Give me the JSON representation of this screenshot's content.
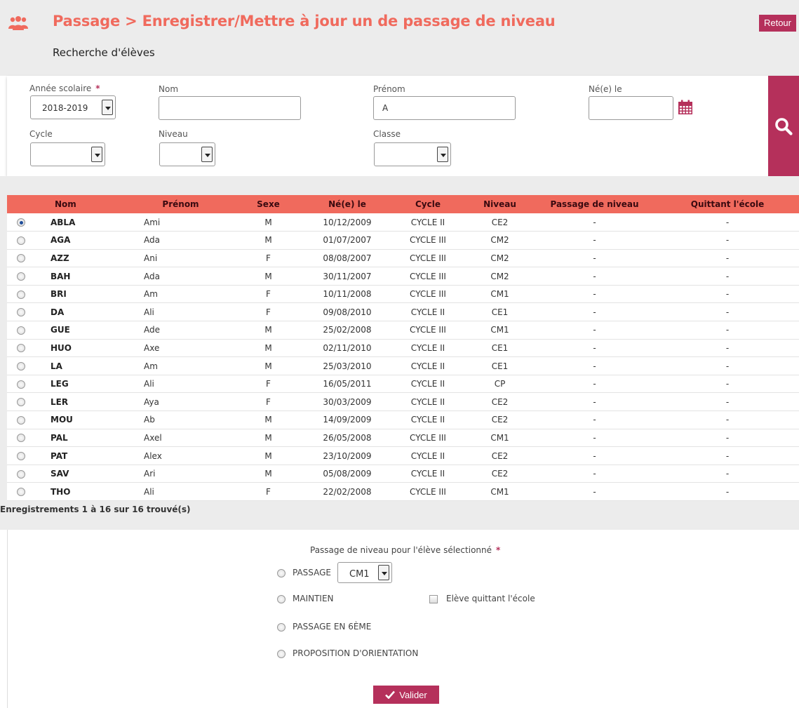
{
  "header": {
    "title": "Passage > Enregistrer/Mettre à jour un de passage de niveau",
    "back_label": "Retour",
    "subtitle": "Recherche d'élèves"
  },
  "search": {
    "annee": {
      "label": "Année scolaire",
      "required_mark": "*",
      "value": "2018-2019"
    },
    "nom": {
      "label": "Nom",
      "value": ""
    },
    "prenom": {
      "label": "Prénom",
      "value": "A"
    },
    "ne_le": {
      "label": "Né(e) le",
      "value": ""
    },
    "cycle": {
      "label": "Cycle",
      "value": ""
    },
    "niveau": {
      "label": "Niveau",
      "value": ""
    },
    "classe": {
      "label": "Classe",
      "value": ""
    },
    "search_icon": "search-icon",
    "calendar_icon": "calendar-icon"
  },
  "table": {
    "columns": [
      "Nom",
      "Prénom",
      "Sexe",
      "Né(e) le",
      "Cycle",
      "Niveau",
      "Passage de niveau",
      "Quittant l'école"
    ],
    "rows": [
      {
        "selected": true,
        "nom": "ABLA",
        "prenom": "Ami",
        "sexe": "M",
        "ne": "10/12/2009",
        "cycle": "CYCLE II",
        "niveau": "CE2",
        "passage": "-",
        "quittant": "-"
      },
      {
        "selected": false,
        "nom": "AGA",
        "prenom": "Ada",
        "sexe": "M",
        "ne": "01/07/2007",
        "cycle": "CYCLE III",
        "niveau": "CM2",
        "passage": "-",
        "quittant": "-"
      },
      {
        "selected": false,
        "nom": "AZZ",
        "prenom": "Ani",
        "sexe": "F",
        "ne": "08/08/2007",
        "cycle": "CYCLE III",
        "niveau": "CM2",
        "passage": "-",
        "quittant": "-"
      },
      {
        "selected": false,
        "nom": "BAH",
        "prenom": "Ada",
        "sexe": "M",
        "ne": "30/11/2007",
        "cycle": "CYCLE III",
        "niveau": "CM2",
        "passage": "-",
        "quittant": "-"
      },
      {
        "selected": false,
        "nom": "BRI",
        "prenom": "Am",
        "sexe": "F",
        "ne": "10/11/2008",
        "cycle": "CYCLE III",
        "niveau": "CM1",
        "passage": "-",
        "quittant": "-"
      },
      {
        "selected": false,
        "nom": "DA",
        "prenom": "Ali",
        "sexe": "F",
        "ne": "09/08/2010",
        "cycle": "CYCLE II",
        "niveau": "CE1",
        "passage": "-",
        "quittant": "-"
      },
      {
        "selected": false,
        "nom": "GUE",
        "prenom": "Ade",
        "sexe": "M",
        "ne": "25/02/2008",
        "cycle": "CYCLE III",
        "niveau": "CM1",
        "passage": "-",
        "quittant": "-"
      },
      {
        "selected": false,
        "nom": "HUO",
        "prenom": "Axe",
        "sexe": "M",
        "ne": "02/11/2010",
        "cycle": "CYCLE II",
        "niveau": "CE1",
        "passage": "-",
        "quittant": "-"
      },
      {
        "selected": false,
        "nom": "LA",
        "prenom": "Am",
        "sexe": "M",
        "ne": "25/03/2010",
        "cycle": "CYCLE II",
        "niveau": "CE1",
        "passage": "-",
        "quittant": "-"
      },
      {
        "selected": false,
        "nom": "LEG",
        "prenom": "Ali",
        "sexe": "F",
        "ne": "16/05/2011",
        "cycle": "CYCLE II",
        "niveau": "CP",
        "passage": "-",
        "quittant": "-"
      },
      {
        "selected": false,
        "nom": "LER",
        "prenom": "Aya",
        "sexe": "F",
        "ne": "30/03/2009",
        "cycle": "CYCLE II",
        "niveau": "CE2",
        "passage": "-",
        "quittant": "-"
      },
      {
        "selected": false,
        "nom": "MOU",
        "prenom": "Ab",
        "sexe": "M",
        "ne": "14/09/2009",
        "cycle": "CYCLE II",
        "niveau": "CE2",
        "passage": "-",
        "quittant": "-"
      },
      {
        "selected": false,
        "nom": "PAL",
        "prenom": "Axel",
        "sexe": "M",
        "ne": "26/05/2008",
        "cycle": "CYCLE III",
        "niveau": "CM1",
        "passage": "-",
        "quittant": "-"
      },
      {
        "selected": false,
        "nom": "PAT",
        "prenom": "Alex",
        "sexe": "M",
        "ne": "23/10/2009",
        "cycle": "CYCLE II",
        "niveau": "CE2",
        "passage": "-",
        "quittant": "-"
      },
      {
        "selected": false,
        "nom": "SAV",
        "prenom": "Ari",
        "sexe": "M",
        "ne": "05/08/2009",
        "cycle": "CYCLE II",
        "niveau": "CE2",
        "passage": "-",
        "quittant": "-"
      },
      {
        "selected": false,
        "nom": "THO",
        "prenom": "Ali",
        "sexe": "F",
        "ne": "22/02/2008",
        "cycle": "CYCLE III",
        "niveau": "CM1",
        "passage": "-",
        "quittant": "-"
      }
    ],
    "records_text": "Enregistrements 1 à 16 sur 16 trouvé(s)"
  },
  "passage": {
    "label": "Passage de niveau pour l'élève sélectionné",
    "required_mark": "*",
    "options": {
      "passage": "PASSAGE",
      "maintien": "MAINTIEN",
      "passage_6eme": "PASSAGE EN 6ÈME",
      "orientation": "PROPOSITION D'ORIENTATION"
    },
    "niveau_value": "CM1",
    "quittant_label": "Elève quittant l'école",
    "valider_label": "Valider"
  },
  "colors": {
    "accent": "#f06a5d",
    "primary": "#b5305b",
    "panel_gray": "#ececec"
  }
}
